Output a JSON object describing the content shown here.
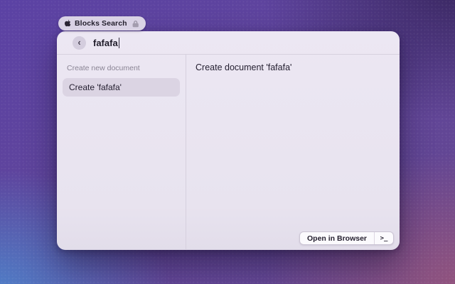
{
  "badge": {
    "label": "Blocks Search"
  },
  "window": {
    "search": {
      "back_glyph": "‹",
      "query": "fafafa"
    },
    "left_panel": {
      "section_header": "Create new document",
      "items": [
        {
          "label": "Create 'fafafa'",
          "selected": true
        }
      ]
    },
    "detail_panel": {
      "title": "Create document 'fafafa'"
    },
    "action_bar": {
      "open_in_browser_label": "Open in Browser",
      "terminal_glyph": ">_"
    }
  },
  "colors": {
    "wallpaper_purple": "#5b42a4",
    "wallpaper_indigo": "#38265f",
    "wallpaper_blue": "#4e80c9",
    "wallpaper_mauve": "#95547c",
    "window_background": "#ebe6f2",
    "selection_background": "#dbd4e3",
    "divider": "#d6d0de",
    "text_primary": "#252031",
    "text_secondary": "#8a8494"
  }
}
